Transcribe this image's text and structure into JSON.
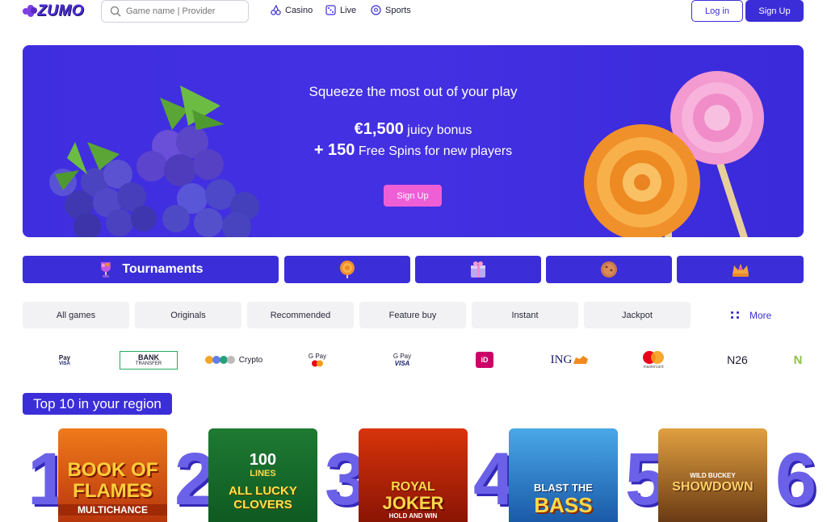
{
  "header": {
    "logo_text": "ZUMO",
    "search_placeholder": "Game name | Provider",
    "nav": [
      {
        "label": "Casino",
        "icon": "cherry-icon"
      },
      {
        "label": "Live",
        "icon": "dice-icon"
      },
      {
        "label": "Sports",
        "icon": "soccer-ball-icon"
      }
    ],
    "login_label": "Log in",
    "signup_label": "Sign Up"
  },
  "hero": {
    "headline": "Squeeze the most out of your play",
    "bonus_amount": "€1,500",
    "bonus_text": " juicy bonus",
    "spins_amount": "+ 150",
    "spins_text": " Free Spins for new players",
    "cta_label": "Sign Up"
  },
  "categories": [
    {
      "label": "Tournaments",
      "icon": "trophy-icon"
    },
    {
      "label": "",
      "icon": "lollipop-icon"
    },
    {
      "label": "",
      "icon": "gift-icon"
    },
    {
      "label": "",
      "icon": "cookie-icon"
    },
    {
      "label": "",
      "icon": "crown-icon"
    }
  ],
  "filters": [
    "All games",
    "Originals",
    "Recommended",
    "Feature buy",
    "Instant",
    "Jackpot"
  ],
  "more_label": "More",
  "payments": {
    "apple_pay_line1": "Pay",
    "apple_pay_line2": "VISA",
    "bank_line1": "BANK",
    "bank_line2": "TRANSFER",
    "crypto_label": "Crypto",
    "gpay_label": "G Pay",
    "gpay_visa_line1": "G Pay",
    "gpay_visa_line2": "VISA",
    "ideal_label": "iD",
    "ing_label": "ING",
    "mastercard_label": "mastercard",
    "n26_label": "N26",
    "neteller_label": "N"
  },
  "top10": {
    "title": "Top 10 in your region",
    "ranks": [
      "1",
      "2",
      "3",
      "4",
      "5",
      "6"
    ],
    "games": [
      {
        "line1": "BOOK OF",
        "line2": "FLAMES",
        "line3": "MULTICHANCE"
      },
      {
        "line1": "100",
        "line2": "LINES",
        "line3": "ALL LUCKY CLOVERS"
      },
      {
        "line1": "ROYAL",
        "line2": "JOKER",
        "line3": "HOLD AND WIN"
      },
      {
        "line1": "BLAST THE",
        "line2": "BASS",
        "line3": ""
      },
      {
        "line1": "WILD BUCKEY",
        "line2": "SHOWDOWN",
        "line3": ""
      }
    ]
  },
  "colors": {
    "brand": "#3b2ed8",
    "cta_pink": "#ee5fd6",
    "pill_bg": "#f2f2f4"
  }
}
